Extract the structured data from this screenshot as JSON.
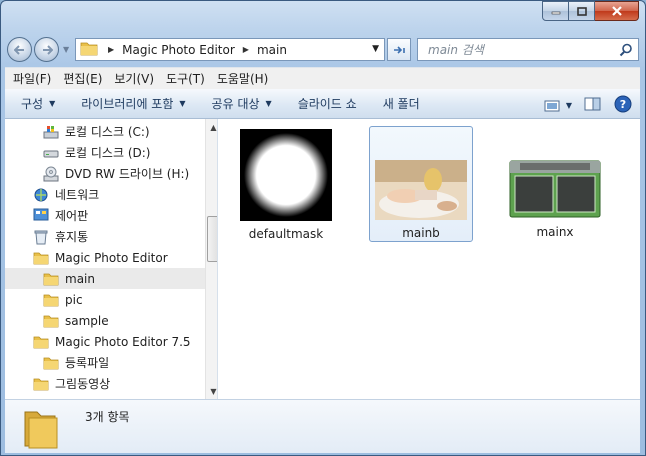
{
  "address": {
    "crumbs": [
      "Magic Photo Editor",
      "main"
    ],
    "search_placeholder": "main 검색"
  },
  "menu": [
    "파일(F)",
    "편집(E)",
    "보기(V)",
    "도구(T)",
    "도움말(H)"
  ],
  "commands": {
    "organize": "구성",
    "include_library": "라이브러리에 포함",
    "share": "공유 대상",
    "slideshow": "슬라이드 쇼",
    "new_folder": "새 폴더"
  },
  "tree": {
    "local_c": "로컬 디스크 (C:)",
    "local_d": "로컬 디스크 (D:)",
    "dvd": "DVD RW 드라이브 (H:)",
    "network": "네트워크",
    "control_panel": "제어판",
    "recycle_bin": "휴지통",
    "mpe": "Magic Photo Editor",
    "main": "main",
    "pic": "pic",
    "sample": "sample",
    "mpe75": "Magic Photo Editor 7.5",
    "register_file": "등록파일",
    "pictures_videos": "그림동영상"
  },
  "files": [
    {
      "name": "defaultmask",
      "icon": "mask-thumbnail-icon"
    },
    {
      "name": "mainb",
      "icon": "photo-thumbnail-icon"
    },
    {
      "name": "mainx",
      "icon": "skin-thumbnail-icon"
    }
  ],
  "details": {
    "count": "3개 항목"
  },
  "colors": {
    "selection": "#7da2ce",
    "folder": "#e9c04a",
    "titlebar": "#bcd3ec"
  }
}
